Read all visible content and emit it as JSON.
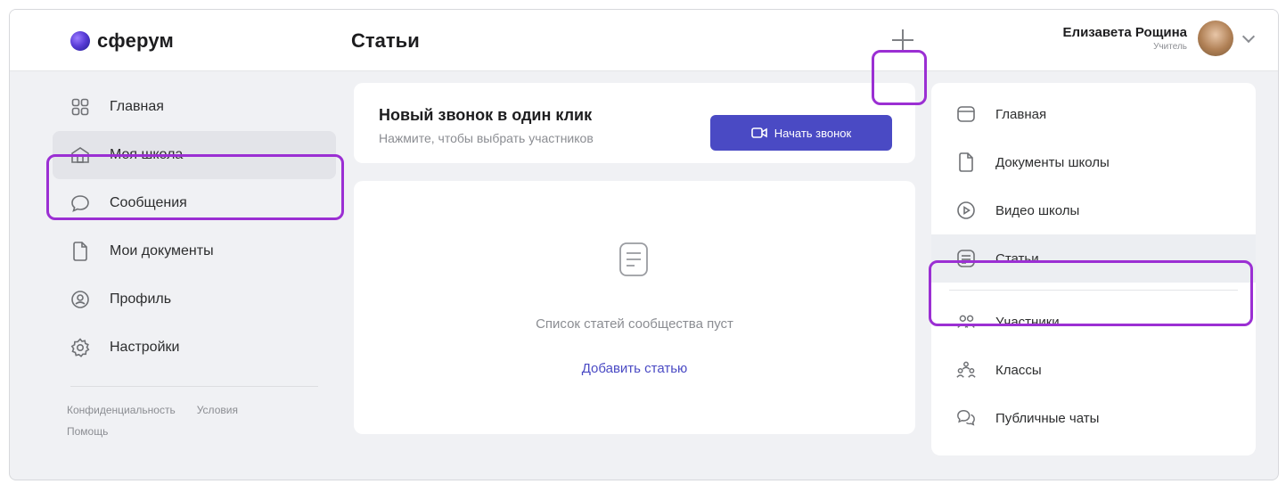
{
  "header": {
    "logo": "сферум",
    "page_title": "Статьи",
    "user": {
      "name": "Елизавета Рощина",
      "role": "Учитель"
    }
  },
  "left_nav": {
    "items": [
      {
        "label": "Главная",
        "icon": "grid-icon"
      },
      {
        "label": "Моя школа",
        "icon": "school-icon",
        "active": true
      },
      {
        "label": "Сообщения",
        "icon": "message-icon"
      },
      {
        "label": "Мои документы",
        "icon": "document-icon"
      },
      {
        "label": "Профиль",
        "icon": "profile-icon"
      },
      {
        "label": "Настройки",
        "icon": "settings-icon"
      }
    ],
    "footer": {
      "privacy": "Конфиденциальность",
      "terms": "Условия",
      "help": "Помощь"
    }
  },
  "call_card": {
    "title": "Новый звонок в один клик",
    "subtitle": "Нажмите, чтобы выбрать участников",
    "button": "Начать звонок"
  },
  "articles": {
    "empty_text": "Список статей сообщества пуст",
    "add_link": "Добавить статью"
  },
  "right_nav": {
    "items": [
      {
        "label": "Главная",
        "icon": "home-icon"
      },
      {
        "label": "Документы школы",
        "icon": "document-icon"
      },
      {
        "label": "Видео школы",
        "icon": "video-icon"
      },
      {
        "label": "Статьи",
        "icon": "article-icon",
        "active": true
      },
      {
        "label": "Участники",
        "icon": "members-icon"
      },
      {
        "label": "Классы",
        "icon": "classes-icon"
      },
      {
        "label": "Публичные чаты",
        "icon": "chat-icon"
      }
    ]
  },
  "colors": {
    "accent": "#4a4ac4",
    "highlight": "#9b2fd3",
    "background": "#f0f1f4"
  }
}
